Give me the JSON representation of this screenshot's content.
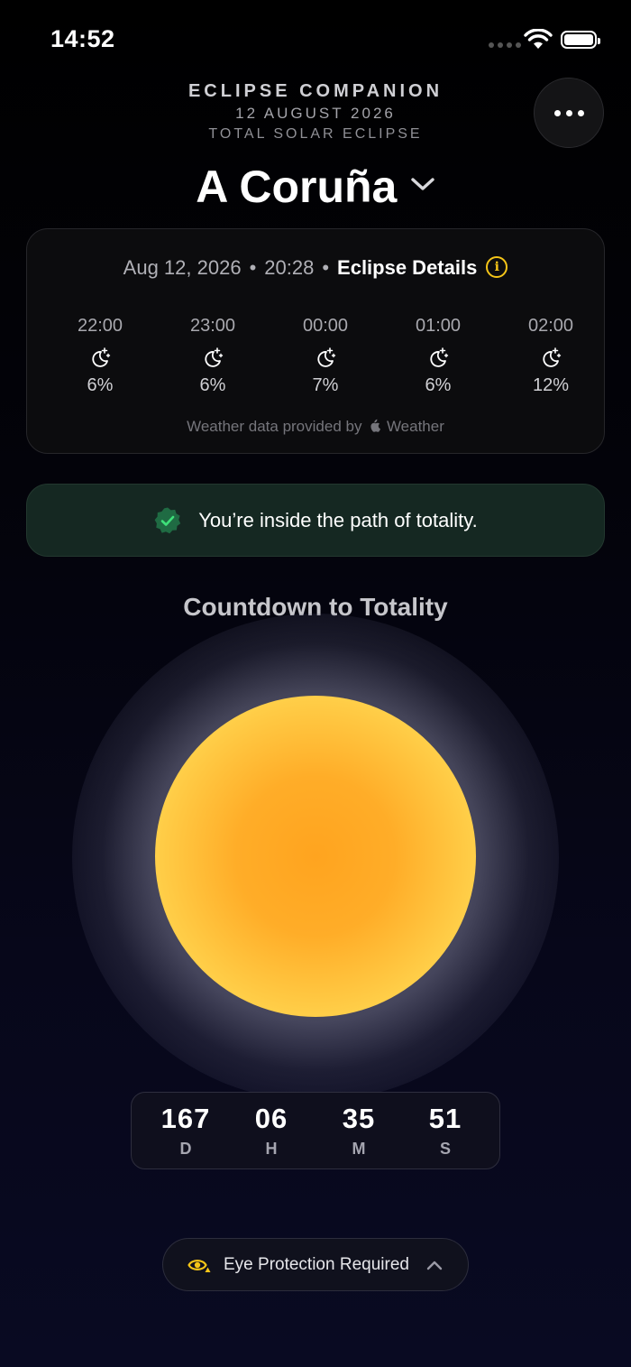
{
  "status": {
    "time": "14:52"
  },
  "header": {
    "app_title": "ECLIPSE COMPANION",
    "date": "12 AUGUST 2026",
    "eclipse_type": "TOTAL SOLAR ECLIPSE"
  },
  "location": {
    "name": "A Coruña"
  },
  "weather_card": {
    "date": "Aug 12, 2026",
    "time": "20:28",
    "details_link": "Eclipse Details",
    "hours": [
      {
        "time": "22:00",
        "icon": "moon-stars-icon",
        "percent": "6%"
      },
      {
        "time": "23:00",
        "icon": "moon-stars-icon",
        "percent": "6%"
      },
      {
        "time": "00:00",
        "icon": "moon-stars-icon",
        "percent": "7%"
      },
      {
        "time": "01:00",
        "icon": "moon-stars-icon",
        "percent": "6%"
      },
      {
        "time": "02:00",
        "icon": "moon-stars-icon",
        "percent": "12%"
      }
    ],
    "credit_prefix": "Weather data provided by",
    "credit_brand": "Weather"
  },
  "totality_banner": {
    "text": "You’re inside the path of totality."
  },
  "countdown": {
    "title": "Countdown to Totality",
    "units": [
      {
        "value": "167",
        "label": "D"
      },
      {
        "value": "06",
        "label": "H"
      },
      {
        "value": "35",
        "label": "M"
      },
      {
        "value": "51",
        "label": "S"
      }
    ]
  },
  "eye_protection": {
    "label": "Eye Protection Required"
  },
  "colors": {
    "accent_yellow": "#f5c518",
    "check_green": "#2ecc71",
    "banner_bg": "#152822",
    "sun_core": "#ffa41f",
    "sun_edge": "#ffec6e"
  }
}
